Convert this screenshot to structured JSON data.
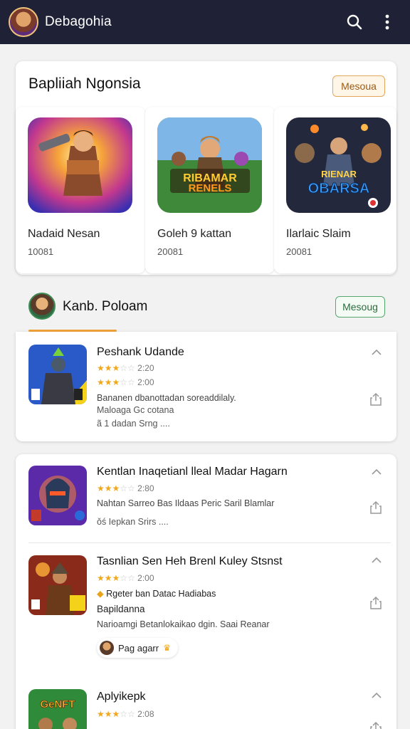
{
  "appbar": {
    "title": "Debagohia",
    "search_icon": "search-icon",
    "menu_icon": "more-vert-icon"
  },
  "featured": {
    "heading": "Bapliiah Ngonsia",
    "more_label": "Mesoua",
    "tiles": [
      {
        "name": "Nadaid Nesan",
        "count": "10081"
      },
      {
        "name": "Goleh 9 kattan",
        "count": "20081"
      },
      {
        "name": "Ilarlaic Slaim",
        "count": "20081"
      }
    ]
  },
  "section": {
    "name": "Kanb. Poloam",
    "more_label": "Mesoug"
  },
  "list1": {
    "title": "Peshank Udande",
    "rating1": "2:20",
    "rating2": "2:00",
    "desc": "Bananen dbanottadan soreaddilaly.",
    "meta1": "Maloaga  Gc cotana",
    "meta2": "ã 1 dadan  Srng  ...."
  },
  "list2": [
    {
      "title": "Kentlan Inaqetianl lleal Madar Hagarn",
      "rating": "2:80",
      "desc": "Nahtan Sarreo  Bas Ildaas  Peric Saril  Blamlar",
      "meta": "ǒś Iepkan Srirs  ...."
    },
    {
      "title": "Tasnlian Sen Heh Brenl Kuley Stsnst",
      "rating": "2:00",
      "tag": "Rgeter ban  Datac  Hadiabas",
      "subtitle": "Bapildanna",
      "desc": "Narioamgi Betanlokaikao dgin. Saai Reanar",
      "chip": "Pag agarr"
    },
    {
      "title": "Aplyikepk",
      "rating": "2:08"
    }
  ],
  "colors": {
    "appbar": "#1f2236",
    "accent_orange": "#f0a23a",
    "accent_green": "#58a86c",
    "star": "#f2a81c"
  }
}
